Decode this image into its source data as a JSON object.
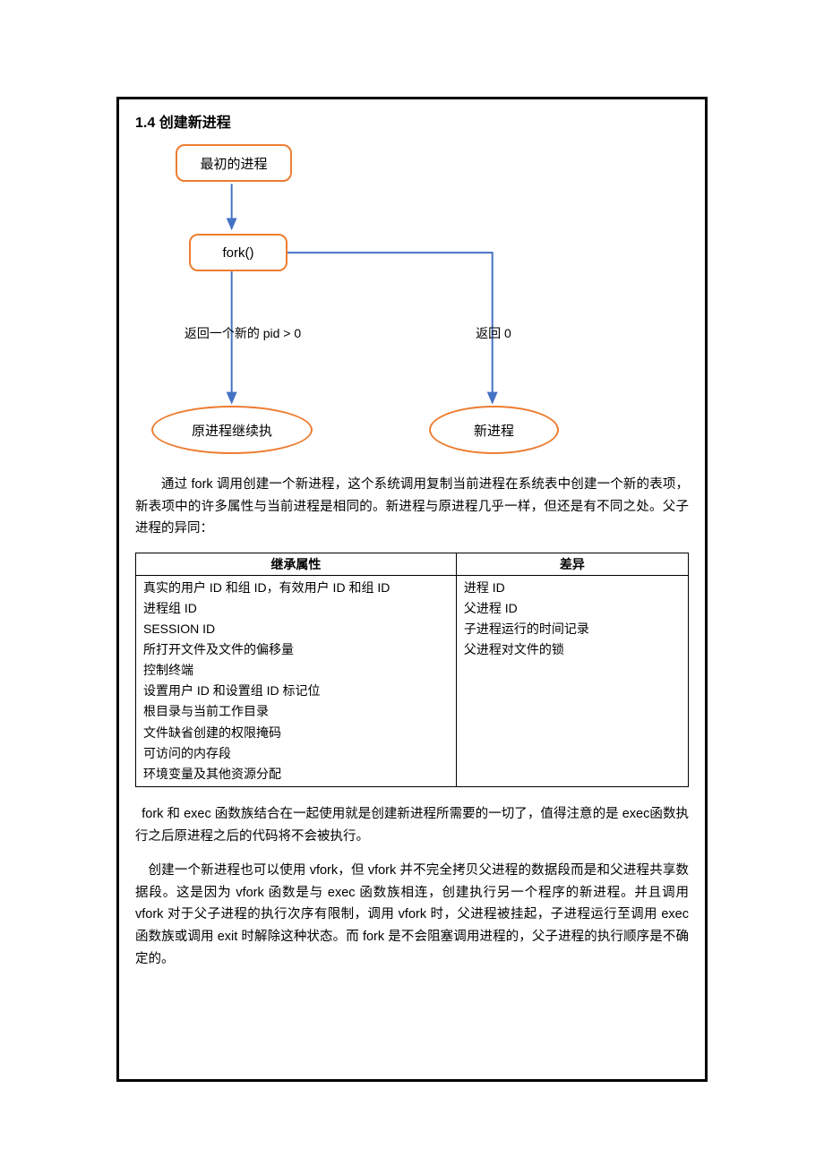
{
  "section_title": "1.4  创建新进程",
  "diagram": {
    "initial_process": "最初的进程",
    "fork_call": "fork()",
    "branch_left_label": "返回一个新的 pid > 0",
    "branch_right_label": "返回 0",
    "left_result": "原进程继续执",
    "right_result": "新进程"
  },
  "para1": "通过 fork 调用创建一个新进程，这个系统调用复制当前进程在系统表中创建一个新的表项，新表项中的许多属性与当前进程是相同的。新进程与原进程几乎一样，但还是有不同之处。父子进程的异同：",
  "table": {
    "header_left": "继承属性",
    "header_right": "差异",
    "left_rows": [
      "真实的用户 ID 和组 ID，有效用户 ID 和组 ID",
      "进程组 ID",
      "SESSION ID",
      "所打开文件及文件的偏移量",
      "控制终端",
      "设置用户 ID 和设置组 ID 标记位",
      "根目录与当前工作目录",
      "文件缺省创建的权限掩码",
      "可访问的内存段",
      "环境变量及其他资源分配"
    ],
    "right_rows": [
      "进程 ID",
      "父进程 ID",
      "子进程运行的时间记录",
      "父进程对文件的锁"
    ]
  },
  "para2": "fork  和  exec 函数族结合在一起使用就是创建新进程所需要的一切了，值得注意的是 exec函数执行之后原进程之后的代码将不会被执行。",
  "para3": "创建一个新进程也可以使用 vfork，但 vfork 并不完全拷贝父进程的数据段而是和父进程共享数据段。这是因为 vfork 函数是与 exec 函数族相连，创建执行另一个程序的新进程。并且调用 vfork 对于父子进程的执行次序有限制，调用 vfork 时，父进程被挂起，子进程运行至调用 exec 函数族或调用 exit 时解除这种状态。而 fork 是不会阻塞调用进程的，父子进程的执行顺序是不确定的。"
}
